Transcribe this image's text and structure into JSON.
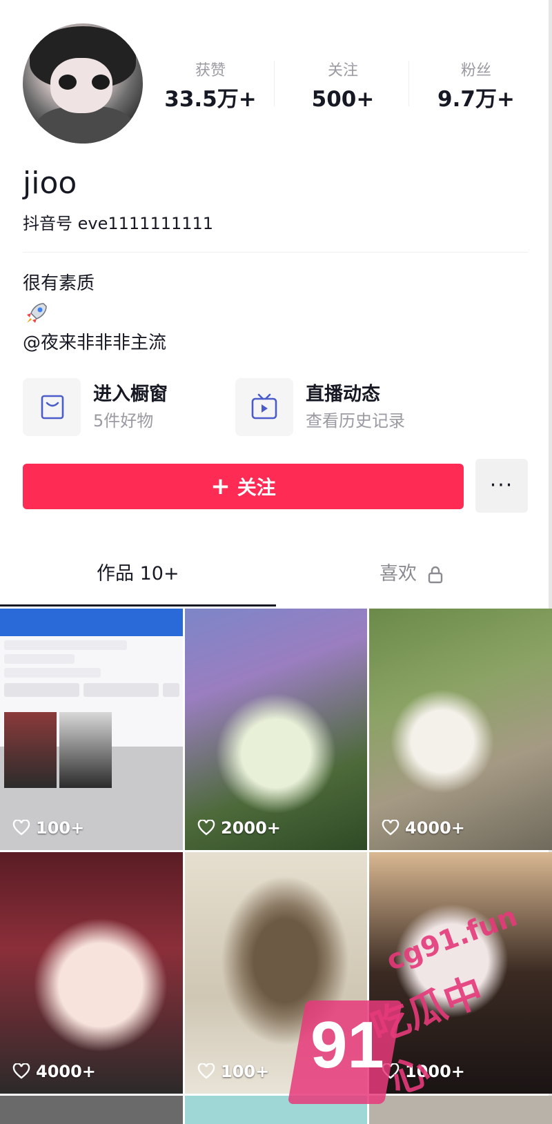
{
  "profile": {
    "name": "jioo",
    "douyin_id": "抖音号 eve1111111111",
    "stats": [
      {
        "label": "获赞",
        "value": "33.5万+"
      },
      {
        "label": "关注",
        "value": "500+"
      },
      {
        "label": "粉丝",
        "value": "9.7万+"
      }
    ],
    "bio": {
      "line1": "很有素质",
      "line3": "@夜来非非非主流"
    }
  },
  "features": [
    {
      "title": "进入橱窗",
      "subtitle": "5件好物",
      "icon": "shopping-bag-icon"
    },
    {
      "title": "直播动态",
      "subtitle": "查看历史记录",
      "icon": "tv-icon"
    }
  ],
  "actions": {
    "follow_label": "关注",
    "more_label": "···"
  },
  "tabs": {
    "works": "作品 10+",
    "likes": "喜欢"
  },
  "grid": [
    {
      "likes": "100+"
    },
    {
      "likes": "2000+"
    },
    {
      "likes": "4000+"
    },
    {
      "likes": "4000+"
    },
    {
      "likes": "100+"
    },
    {
      "likes": "1000+"
    }
  ],
  "watermark": {
    "number": "91",
    "site": "cg91.fun",
    "text": "吃瓜中心"
  },
  "colors": {
    "accent": "#fe2c55",
    "text": "#161823",
    "muted": "#9a9ba2"
  }
}
